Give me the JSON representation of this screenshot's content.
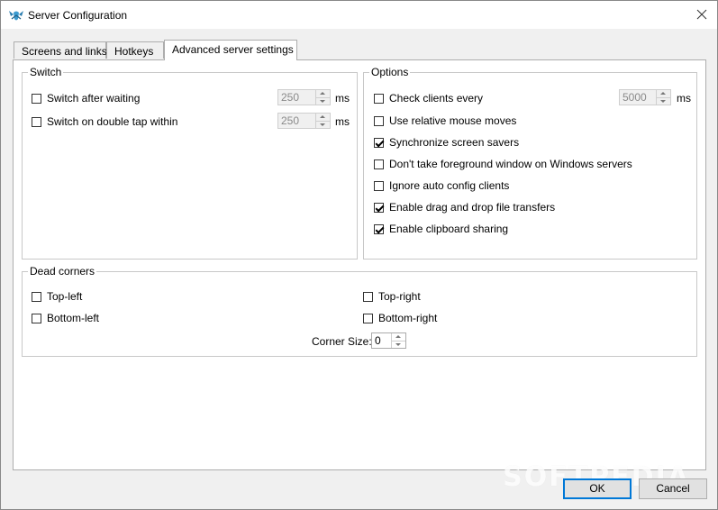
{
  "window": {
    "title": "Server Configuration"
  },
  "tabs": [
    {
      "label": "Screens and links",
      "active": false
    },
    {
      "label": "Hotkeys",
      "active": false
    },
    {
      "label": "Advanced server settings",
      "active": true
    }
  ],
  "switch_group": {
    "title": "Switch",
    "items": [
      {
        "label": "Switch after waiting",
        "checked": false,
        "value": "250",
        "unit": "ms"
      },
      {
        "label": "Switch on double tap within",
        "checked": false,
        "value": "250",
        "unit": "ms"
      }
    ]
  },
  "options_group": {
    "title": "Options",
    "check_clients": {
      "label": "Check clients every",
      "checked": false,
      "value": "5000",
      "unit": "ms"
    },
    "items": [
      {
        "label": "Use relative mouse moves",
        "checked": false
      },
      {
        "label": "Synchronize screen savers",
        "checked": true
      },
      {
        "label": "Don't take foreground window on Windows servers",
        "checked": false
      },
      {
        "label": "Ignore auto config clients",
        "checked": false
      },
      {
        "label": "Enable drag and drop file transfers",
        "checked": true
      },
      {
        "label": "Enable clipboard sharing",
        "checked": true
      }
    ]
  },
  "dead_corners": {
    "title": "Dead corners",
    "top_left": {
      "label": "Top-left",
      "checked": false
    },
    "top_right": {
      "label": "Top-right",
      "checked": false
    },
    "bottom_left": {
      "label": "Bottom-left",
      "checked": false
    },
    "bottom_right": {
      "label": "Bottom-right",
      "checked": false
    },
    "corner_size_label": "Corner Size:",
    "corner_size_value": "0"
  },
  "buttons": {
    "ok": "OK",
    "cancel": "Cancel"
  },
  "watermark": "SOFTPEDIA",
  "icons": {
    "app": "synergy-logo-icon",
    "close": "close-icon"
  }
}
